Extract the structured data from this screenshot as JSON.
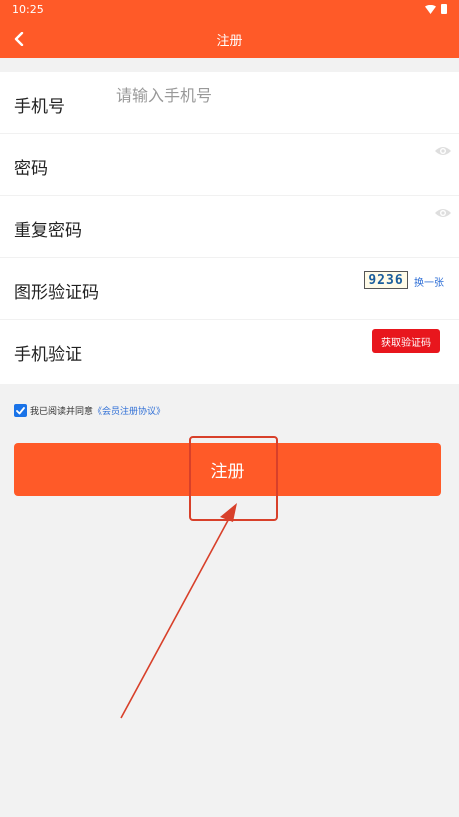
{
  "status_bar": {
    "time": "10:25"
  },
  "nav": {
    "title": "注册"
  },
  "form": {
    "phone": {
      "label": "手机号",
      "placeholder": "请输入手机号",
      "value": ""
    },
    "password": {
      "label": "密码",
      "placeholder": "",
      "value": ""
    },
    "password_repeat": {
      "label": "重复密码",
      "placeholder": "",
      "value": ""
    },
    "captcha": {
      "label": "图形验证码",
      "image_text": "9236",
      "refresh_label": "换一张"
    },
    "sms": {
      "label": "手机验证",
      "button_label": "获取验证码"
    }
  },
  "agreement": {
    "checked": true,
    "text": "我已阅读并同意",
    "link_text": "《会员注册协议》"
  },
  "submit": {
    "label": "注册"
  },
  "colors": {
    "primary": "#ff5a28",
    "sms_button": "#e8161d",
    "link": "#2f6fd6",
    "annotation": "#d8402a"
  }
}
